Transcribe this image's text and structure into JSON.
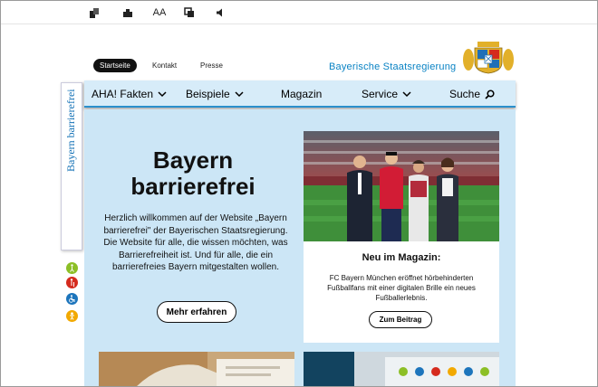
{
  "toolbar": {
    "icons": [
      "contrast-icon",
      "puzzle-icon",
      "font-size-icon",
      "copy-icon",
      "speaker-icon"
    ],
    "font_size_label": "AA"
  },
  "meta_nav": {
    "home": "Startseite",
    "contact": "Kontakt",
    "press": "Presse"
  },
  "header": {
    "gov_title": "Bayerische Staatsregierung"
  },
  "side_tab": {
    "label": "Bayern barrierefrei"
  },
  "main_nav": {
    "items": [
      {
        "label": "AHA! Fakten",
        "dropdown": true
      },
      {
        "label": "Beispiele",
        "dropdown": true
      },
      {
        "label": "Magazin",
        "dropdown": false
      },
      {
        "label": "Service",
        "dropdown": true
      },
      {
        "label": "Suche",
        "search": true
      }
    ]
  },
  "hero": {
    "title_line1": "Bayern",
    "title_line2": "barrierefrei",
    "text": "Herzlich willkommen auf der Website „Bayern barrierefrei\" der Bayerischen Staatsregierung. Die Website für alle, die wissen möchten, was Barrierefreiheit ist. Und für alle, die ein barrierefreies Bayern mitgestalten wollen.",
    "button": "Mehr erfahren"
  },
  "magazine_card": {
    "title": "Neu im Magazin:",
    "text": "FC Bayern München eröffnet hörbehinderten Fußballfans mit einer digitalen Brille ein neues Fußballerlebnis.",
    "button": "Zum Beitrag"
  },
  "colors": {
    "accent_blue": "#0a83c4",
    "nav_bg": "#d7ecf9",
    "content_bg": "#cce6f6",
    "text": "#111111"
  }
}
